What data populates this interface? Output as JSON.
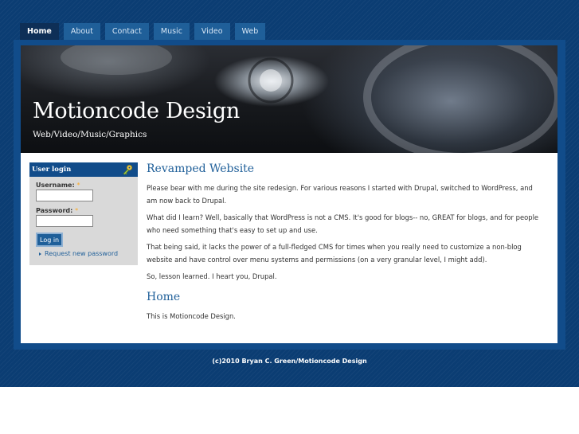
{
  "nav": {
    "tabs": [
      {
        "label": "Home"
      },
      {
        "label": "About"
      },
      {
        "label": "Contact"
      },
      {
        "label": "Music"
      },
      {
        "label": "Video"
      },
      {
        "label": "Web"
      }
    ]
  },
  "header": {
    "title": "Motioncode Design",
    "slogan": "Web/Video/Music/Graphics"
  },
  "login_block": {
    "title": "User login",
    "username_label": "Username:",
    "password_label": "Password:",
    "required_marker": "*",
    "username_value": "",
    "password_value": "",
    "submit_label": "Log in",
    "request_password_label": "Request new password"
  },
  "articles": [
    {
      "title": "Revamped Website",
      "paragraphs": [
        "Please bear with me during the site redesign. For various reasons I started with Drupal, switched to WordPress, and am now back to Drupal.",
        "What did I learn? Well, basically that WordPress is not a CMS. It's good for blogs-- no, GREAT for blogs, and for people who need something that's easy to set up and use.",
        "That being said, it lacks the power of a full-fledged CMS for times when you really need to customize a non-blog website and have control over menu systems and permissions (on a very granular level, I might add).",
        "So, lesson learned. I heart you, Drupal."
      ]
    },
    {
      "title": "Home",
      "paragraphs": [
        "This is Motioncode Design."
      ]
    }
  ],
  "footer": {
    "text": "(c)2010 Bryan C. Green/Motioncode Design"
  },
  "colors": {
    "page_bg": "#0b3d73",
    "frame": "#114c8a",
    "tab": "#1f5f99",
    "tab_active": "#0e2f57",
    "heading": "#1f5f99"
  },
  "icons": {
    "login_block": "key-icon",
    "request_link": "arrow-right-icon"
  }
}
